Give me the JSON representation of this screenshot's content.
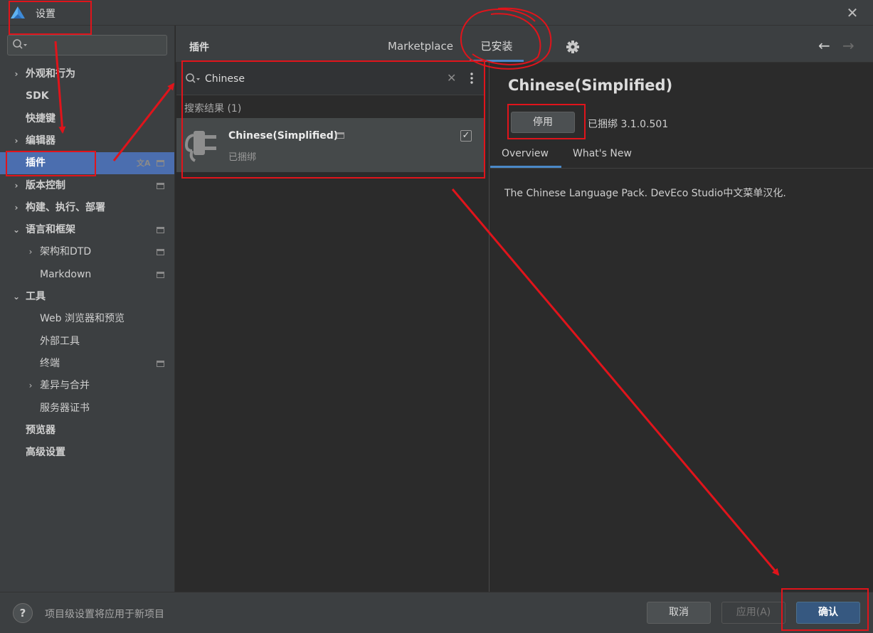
{
  "window": {
    "title": "设置"
  },
  "sidebar": {
    "search_placeholder": "",
    "items": [
      {
        "label": "外观和行为",
        "expandable": true,
        "bold": true,
        "icon": ""
      },
      {
        "label": "SDK",
        "expandable": false,
        "bold": true,
        "icon": ""
      },
      {
        "label": "快捷键",
        "expandable": false,
        "bold": true,
        "icon": ""
      },
      {
        "label": "编辑器",
        "expandable": true,
        "bold": true,
        "icon": ""
      },
      {
        "label": "插件",
        "expandable": false,
        "bold": true,
        "selected": true,
        "icon": "translate-icon,page-icon"
      },
      {
        "label": "版本控制",
        "expandable": true,
        "bold": true,
        "icon": "page-icon"
      },
      {
        "label": "构建、执行、部署",
        "expandable": true,
        "bold": true,
        "icon": ""
      },
      {
        "label": "语言和框架",
        "expandable": true,
        "expanded": true,
        "bold": true,
        "icon": "page-icon"
      },
      {
        "label": "架构和DTD",
        "expandable": true,
        "bold": false,
        "indent": 1,
        "icon": "page-icon"
      },
      {
        "label": "Markdown",
        "expandable": false,
        "bold": false,
        "indent": 1,
        "icon": "page-icon"
      },
      {
        "label": "工具",
        "expandable": true,
        "expanded": true,
        "bold": true,
        "icon": ""
      },
      {
        "label": "Web 浏览器和预览",
        "expandable": false,
        "bold": false,
        "indent": 1,
        "icon": ""
      },
      {
        "label": "外部工具",
        "expandable": false,
        "bold": false,
        "indent": 1,
        "icon": ""
      },
      {
        "label": "终端",
        "expandable": false,
        "bold": false,
        "indent": 1,
        "icon": "page-icon"
      },
      {
        "label": "差异与合并",
        "expandable": true,
        "bold": false,
        "indent": 1,
        "icon": ""
      },
      {
        "label": "服务器证书",
        "expandable": false,
        "bold": false,
        "indent": 1,
        "icon": ""
      },
      {
        "label": "预览器",
        "expandable": false,
        "bold": true,
        "icon": ""
      },
      {
        "label": "高级设置",
        "expandable": false,
        "bold": true,
        "icon": ""
      }
    ]
  },
  "header": {
    "section_title": "插件",
    "tabs": [
      {
        "label": "Marketplace",
        "active": false
      },
      {
        "label": "已安装",
        "active": true
      }
    ]
  },
  "plugin_list": {
    "search_value": "Chinese",
    "results_label": "搜索结果 (1)",
    "items": [
      {
        "name": "Chinese(Simplified)",
        "status": "已捆绑",
        "enabled": true
      }
    ]
  },
  "detail": {
    "title": "Chinese(Simplified)",
    "disable_button": "停用",
    "bundled_version": "已捆绑 3.1.0.501",
    "tabs": [
      {
        "label": "Overview",
        "active": true
      },
      {
        "label": "What's New",
        "active": false
      }
    ],
    "description": "The Chinese Language Pack. DevEco Studio中文菜单汉化."
  },
  "footer": {
    "note": "项目级设置将应用于新项目",
    "cancel": "取消",
    "apply": "应用(A)",
    "ok": "确认"
  },
  "colors": {
    "accent": "#4a88c7",
    "selection": "#4b6eaf",
    "annotation": "#e0141b",
    "primary_button": "#365880"
  }
}
